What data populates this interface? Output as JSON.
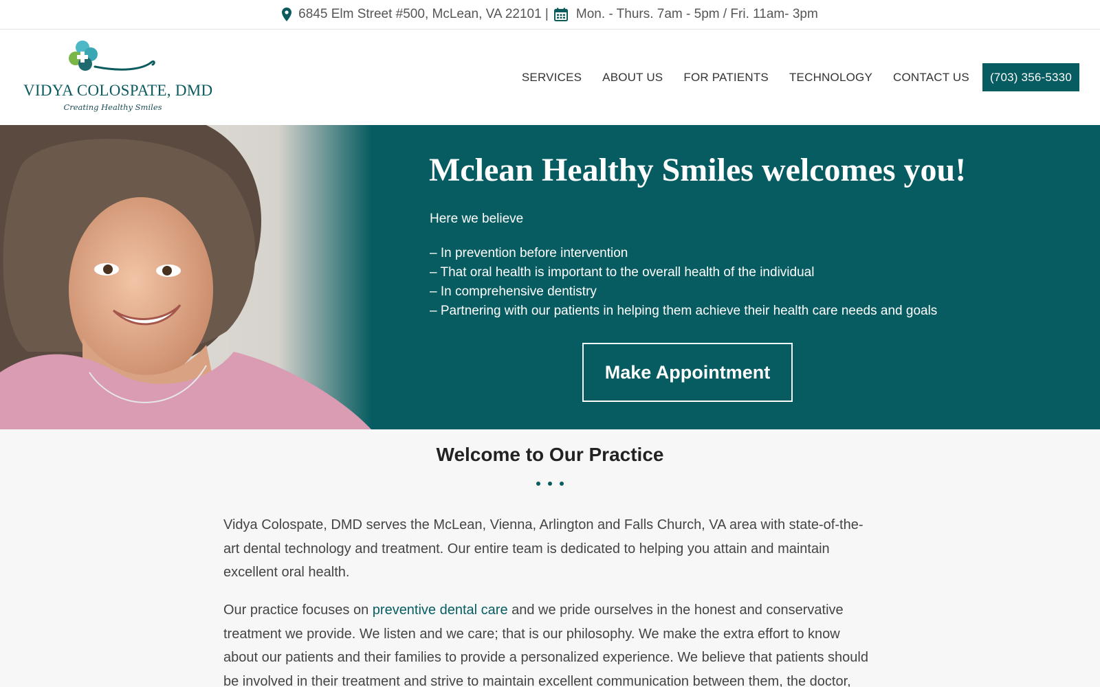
{
  "topbar": {
    "address": "6845 Elm Street #500, McLean, VA 22101 |",
    "hours": "Mon. - Thurs. 7am - 5pm / Fri. 11am- 3pm"
  },
  "logo": {
    "brand": "VIDYA COLOSPATE, DMD",
    "tagline": "Creating Healthy Smiles"
  },
  "nav": {
    "items": [
      "SERVICES",
      "ABOUT US",
      "FOR PATIENTS",
      "TECHNOLOGY",
      "CONTACT US"
    ],
    "phone": "(703) 356-5330"
  },
  "hero": {
    "title": "Mclean Healthy Smiles welcomes you!",
    "intro": "Here we believe",
    "beliefs": [
      "– In prevention before intervention",
      "– That oral health is important to the overall health of the individual",
      "– In comprehensive dentistry",
      "– Partnering with our patients in helping them achieve their health care needs and goals"
    ],
    "cta_label": "Make Appointment"
  },
  "welcome": {
    "title": "Welcome to Our Practice",
    "paragraph1": "Vidya Colospate, DMD serves the McLean, Vienna, Arlington and Falls Church, VA area with state-of-the-art dental technology and treatment. Our entire team is dedicated to helping you attain and maintain excellent oral health.",
    "paragraph2_before": "Our practice focuses on ",
    "paragraph2_link": "preventive dental care",
    "paragraph2_after": " and we pride ourselves in the honest and conservative treatment we provide. We listen and we care; that is our philosophy. We make the extra effort to know about our patients and their families to provide a personalized experience. We believe that patients should be involved in their treatment and strive to maintain excellent communication between them, the doctor, and"
  },
  "colors": {
    "brand_teal": "#075c61",
    "page_background": "#f7f7f7"
  },
  "icons": [
    "map-pin-icon",
    "calendar-icon",
    "clover-tooth-logo-icon"
  ]
}
